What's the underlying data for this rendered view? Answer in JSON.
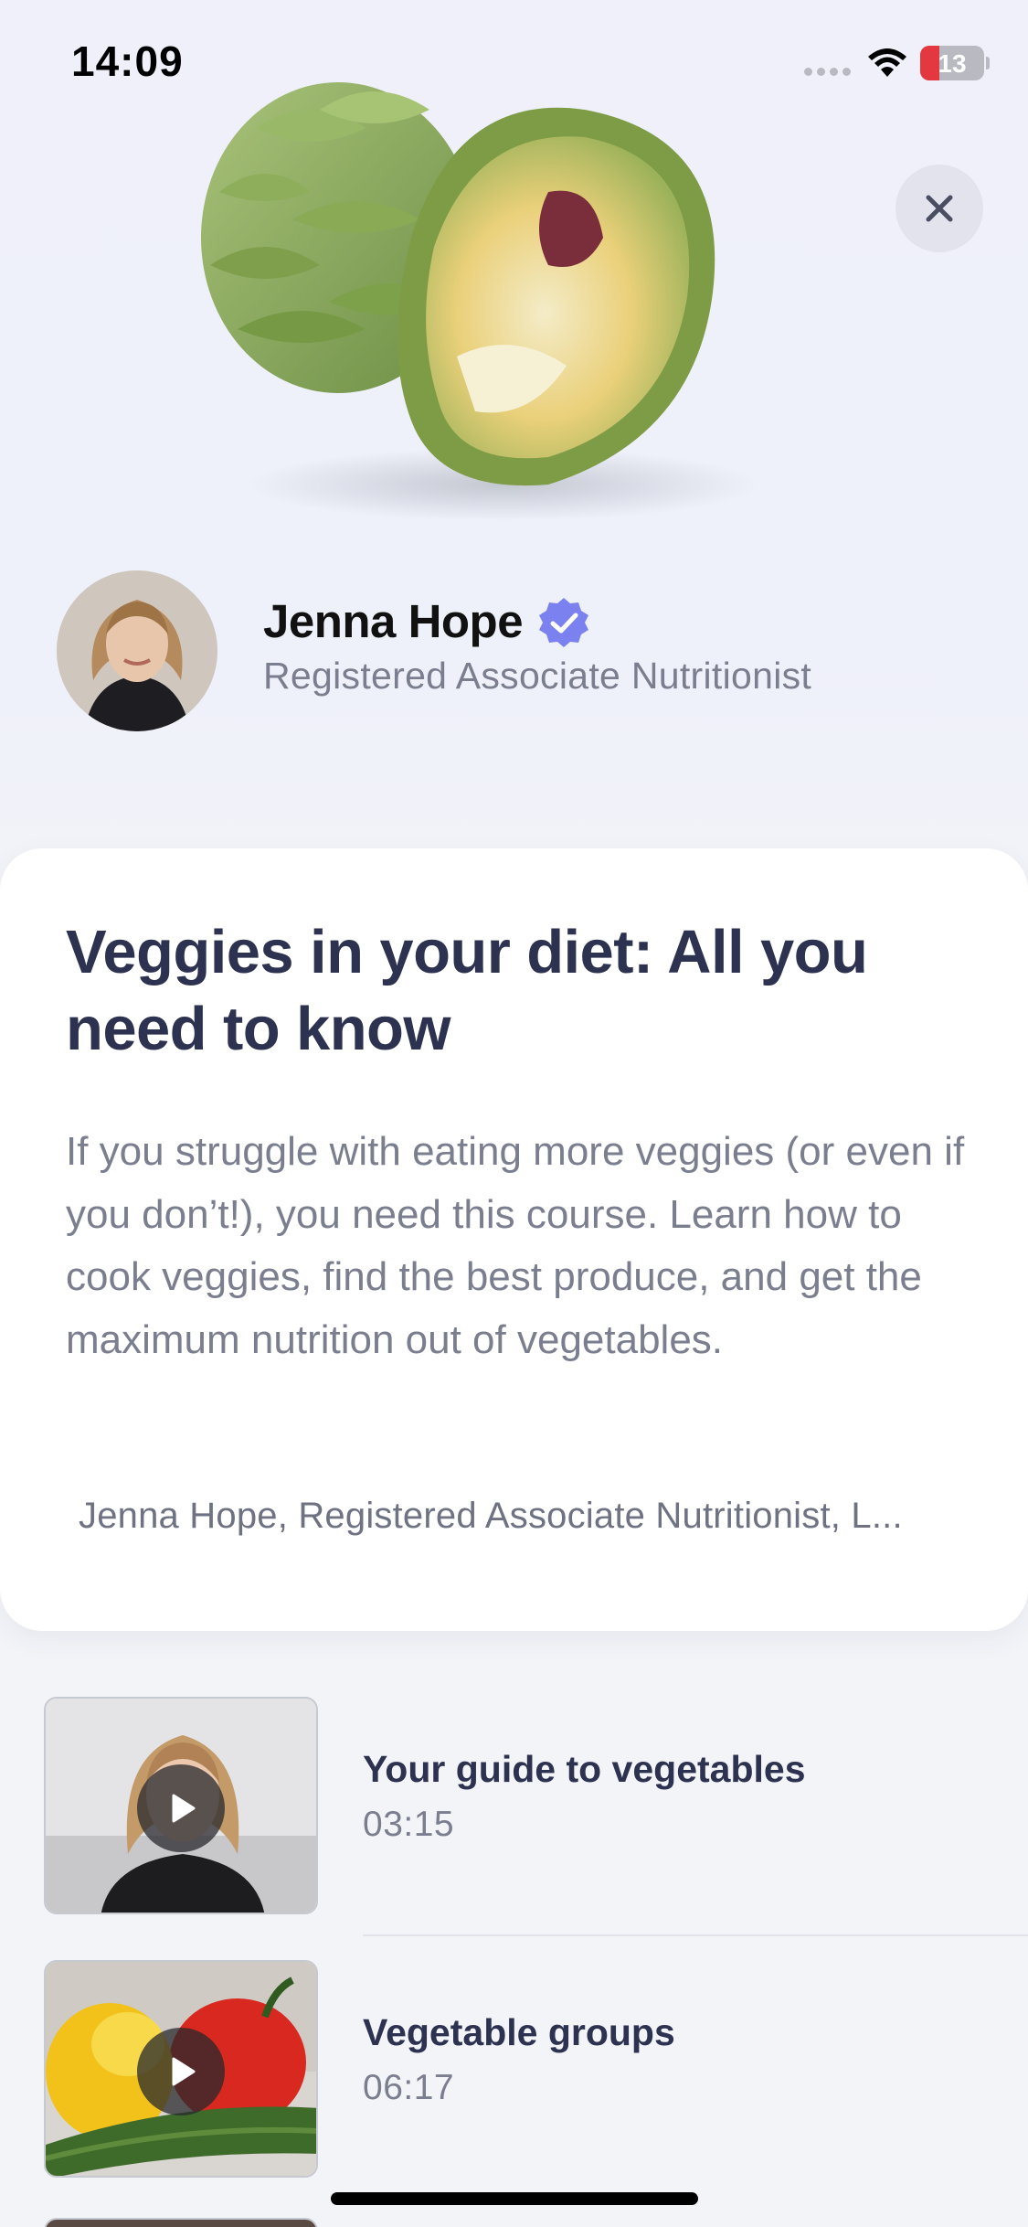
{
  "status_bar": {
    "time": "14:09",
    "battery_level": "13",
    "battery_color": "#e3383f"
  },
  "header": {
    "hero_image": "artichoke-image",
    "close_icon": "close-icon"
  },
  "author": {
    "name": "Jenna Hope",
    "title": "Registered Associate Nutritionist",
    "verified_icon": "verified-badge-icon",
    "verified_color": "#7b82f0"
  },
  "course": {
    "title": "Veggies in your diet: All you need to know",
    "description": "If you struggle with eating more veggies (or even if you don’t!), you need this course. Learn how to cook veggies, find the best produce, and get the maximum nutrition out of vegetables.",
    "credits": "Jenna Hope, Registered Associate Nutritionist, L..."
  },
  "lessons": [
    {
      "title": "Your guide to vegetables",
      "duration": "03:15",
      "icon": "play-icon"
    },
    {
      "title": "Vegetable groups",
      "duration": "06:17",
      "icon": "play-icon"
    }
  ]
}
